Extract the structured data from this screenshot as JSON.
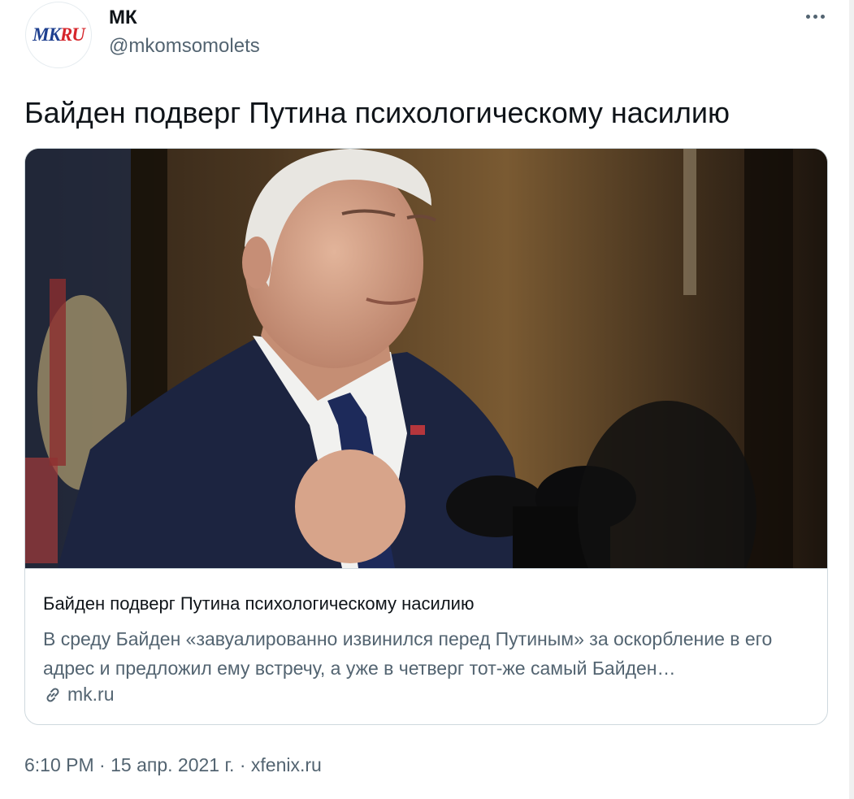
{
  "author": {
    "display_name": "МК",
    "handle": "@mkomsomolets",
    "avatar_logo_mk": "MK",
    "avatar_logo_ru": "RU"
  },
  "tweet": {
    "text": "Байден подверг Путина психологическому насилию"
  },
  "card": {
    "image_alt": "Joe Biden speaking at microphones",
    "title": "Байден подверг Путина психологическому насилию",
    "description": "В среду Байден «завуалированно извинился перед Путиным» за оскорбление в его адрес и предложил ему встречу, а уже в четверг тот-же самый Байден…",
    "domain": "mk.ru"
  },
  "meta": {
    "time": "6:10 PM",
    "separator": " · ",
    "date": "15 апр. 2021 г.",
    "source": "xfenix.ru"
  },
  "icons": {
    "more": "more-dots-icon",
    "link": "link-icon"
  },
  "colors": {
    "text_primary": "#0f1419",
    "text_secondary": "#536471",
    "border": "#cfd9de",
    "logo_blue": "#1e3f8f",
    "logo_red": "#d6262b"
  }
}
